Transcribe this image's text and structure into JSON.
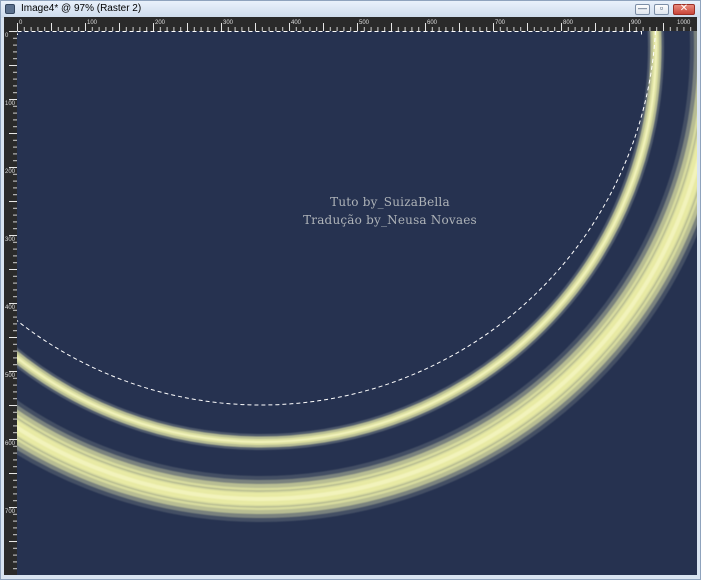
{
  "window": {
    "title": "Image4* @  97% (Raster 2)",
    "buttons": {
      "minimize": "—",
      "maximize": "▫",
      "close": "✕"
    }
  },
  "ruler": {
    "top_labels": [
      "0",
      "100",
      "200",
      "300",
      "400",
      "500",
      "600",
      "700",
      "800",
      "900",
      "1000"
    ],
    "left_labels": [
      "0",
      "100",
      "200",
      "300",
      "400",
      "500",
      "600",
      "700"
    ]
  },
  "canvas": {
    "background_color": "#263250",
    "ring_color": "#e8eaa4",
    "watermark": {
      "line1": "Tuto by_SuizaBella",
      "line2": "Tradução by_Neusa Novaes"
    }
  }
}
